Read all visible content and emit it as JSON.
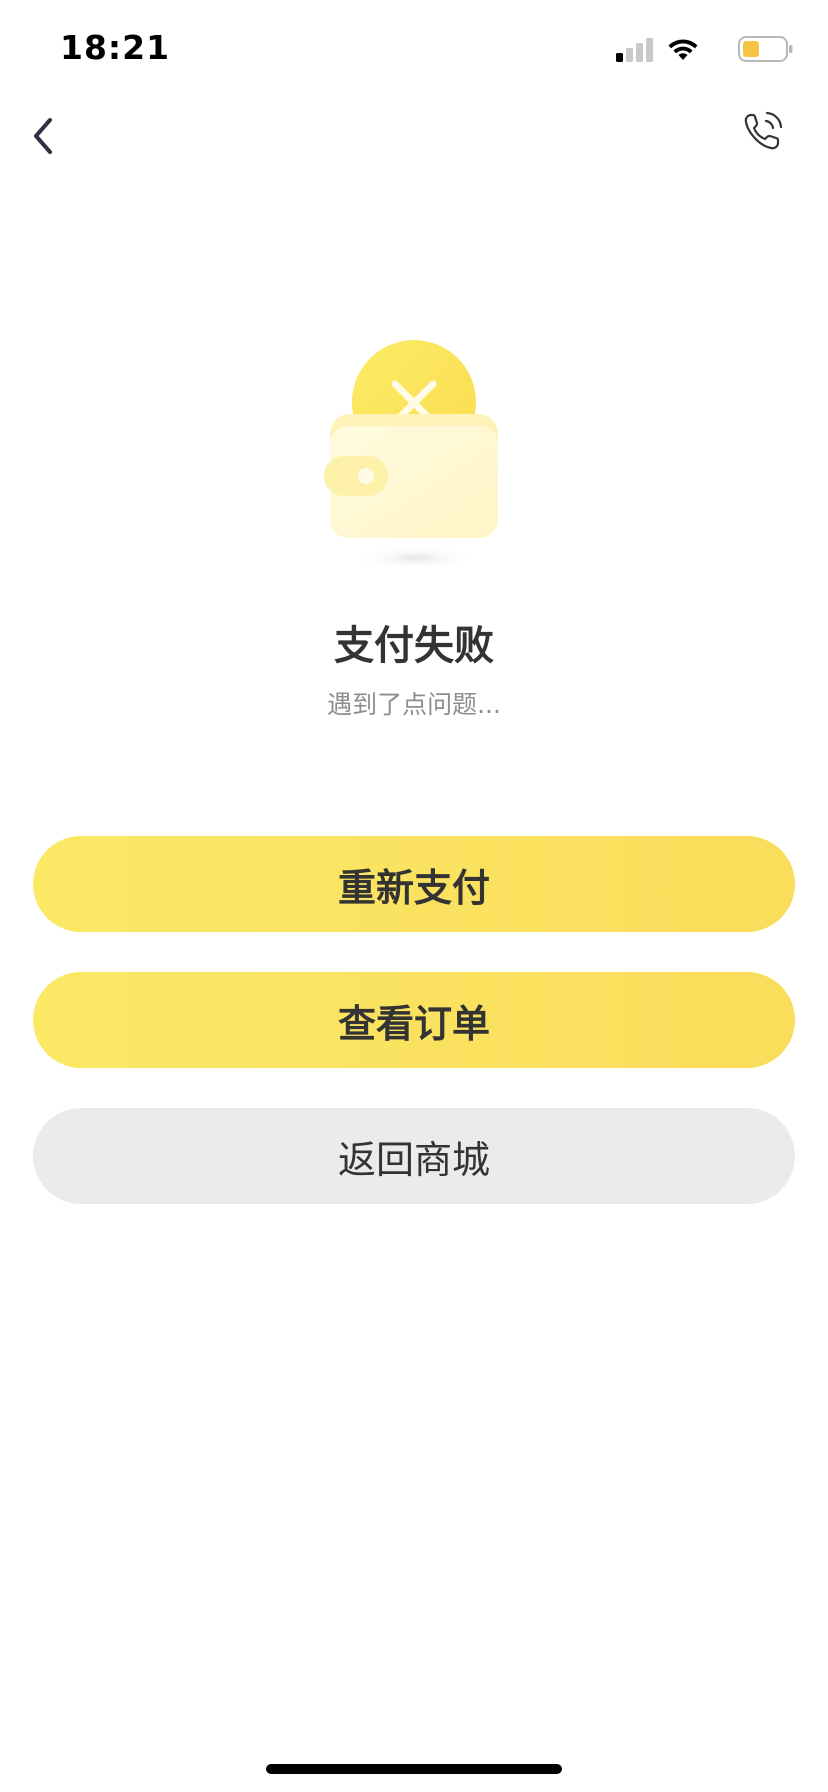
{
  "status_bar": {
    "time": "18:21"
  },
  "nav": {
    "back_icon": "chevron-left-icon",
    "phone_icon": "phone-icon"
  },
  "result": {
    "title": "支付失败",
    "subtitle": "遇到了点问题..."
  },
  "actions": {
    "retry_label": "重新支付",
    "view_order_label": "查看订单",
    "back_to_mall_label": "返回商城"
  },
  "colors": {
    "primary_button": "#f9e160",
    "secondary_button": "#ebebed",
    "text": "#333333",
    "subtext": "#8e8e8e",
    "accent_yellow": "#fbe055"
  }
}
